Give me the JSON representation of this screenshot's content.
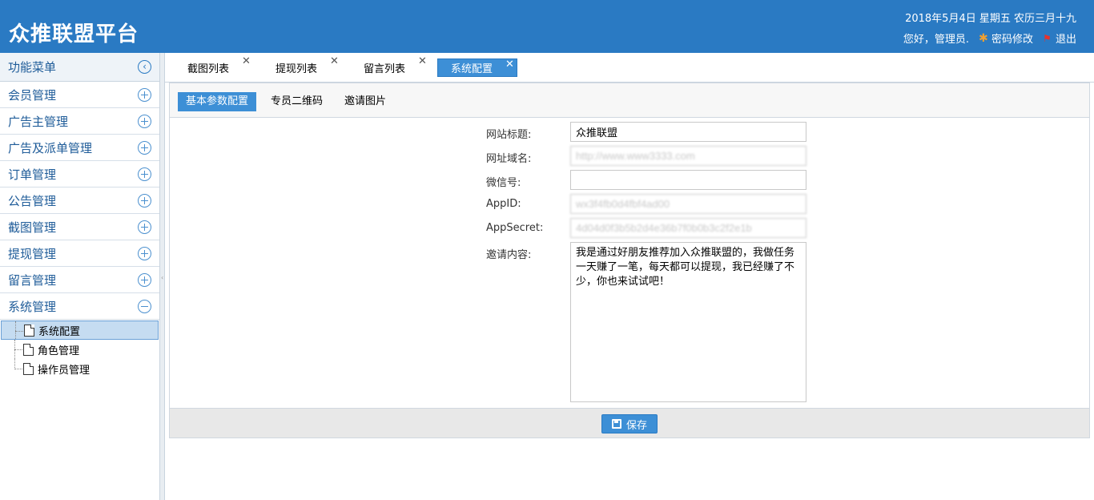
{
  "header": {
    "title": "众推联盟平台",
    "date": "2018年5月4日 星期五 农历三月十九",
    "greeting": "您好，管理员.",
    "change_password": "密码修改",
    "logout": "退出"
  },
  "sidebar": {
    "heading": "功能菜单",
    "items": [
      {
        "label": "会员管理"
      },
      {
        "label": "广告主管理"
      },
      {
        "label": "广告及派单管理"
      },
      {
        "label": "订单管理"
      },
      {
        "label": "公告管理"
      },
      {
        "label": "截图管理"
      },
      {
        "label": "提现管理"
      },
      {
        "label": "留言管理"
      },
      {
        "label": "系统管理"
      }
    ],
    "tree": [
      {
        "label": "系统配置"
      },
      {
        "label": "角色管理"
      },
      {
        "label": "操作员管理"
      }
    ]
  },
  "tabs": [
    {
      "label": "截图列表"
    },
    {
      "label": "提现列表"
    },
    {
      "label": "留言列表"
    },
    {
      "label": "系统配置"
    }
  ],
  "subtabs": [
    {
      "label": "基本参数配置"
    },
    {
      "label": "专员二维码"
    },
    {
      "label": "邀请图片"
    }
  ],
  "form": {
    "site_title": {
      "label": "网站标题:",
      "value": "众推联盟"
    },
    "domain": {
      "label": "网址域名:",
      "value": "http://www.www3333.com"
    },
    "wechat": {
      "label": "微信号:",
      "value": ""
    },
    "appid": {
      "label": "AppID:",
      "value": "wx3f4fb0d4fbf4ad00"
    },
    "appsecret": {
      "label": "AppSecret:",
      "value": "4d04d0f3b5b2d4e36b7f0b0b3c2f2e1b"
    },
    "invite": {
      "label": "邀请内容:",
      "value": "我是通过好朋友推荐加入众推联盟的，我做任务一天赚了一笔，每天都可以提现，我已经赚了不少，你也来试试吧！"
    }
  },
  "save_label": "保存"
}
